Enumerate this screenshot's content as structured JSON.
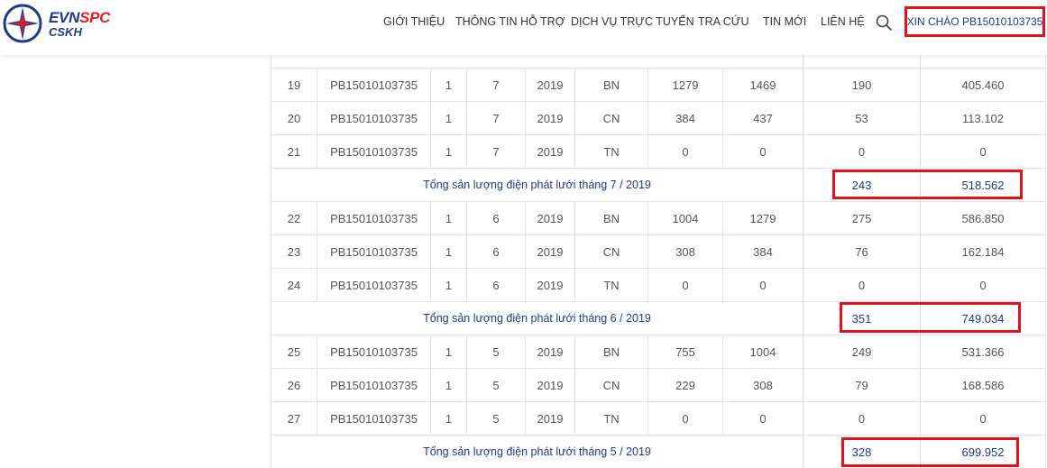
{
  "header": {
    "logo": {
      "brand": "EVN",
      "brand_accent": "SPC",
      "sub": "CSKH"
    },
    "nav": [
      "GIỚI THIỆU",
      "THÔNG TIN HỖ TRỢ",
      "DỊCH VỤ TRỰC TUYẾN",
      "TRA CỨU",
      "TIN MỚI",
      "LIÊN HỆ"
    ],
    "greeting": "XIN CHÀO PB15010103735"
  },
  "colors": {
    "brand_blue": "#1d3a8f",
    "brand_red": "#e31e24",
    "highlight": "#e0121c"
  },
  "table": {
    "rows": [
      {
        "type": "data",
        "cells": [
          "19",
          "PB15010103735",
          "1",
          "7",
          "2019",
          "BN",
          "1279",
          "1469",
          "190",
          "405.460"
        ]
      },
      {
        "type": "data",
        "cells": [
          "20",
          "PB15010103735",
          "1",
          "7",
          "2019",
          "CN",
          "384",
          "437",
          "53",
          "113.102"
        ]
      },
      {
        "type": "data",
        "cells": [
          "21",
          "PB15010103735",
          "1",
          "7",
          "2019",
          "TN",
          "0",
          "0",
          "0",
          "0"
        ]
      },
      {
        "type": "summary",
        "label": "Tổng sản lượng điện phát lưới tháng 7 / 2019",
        "kwh": "243",
        "amount": "518.562"
      },
      {
        "type": "data",
        "cells": [
          "22",
          "PB15010103735",
          "1",
          "6",
          "2019",
          "BN",
          "1004",
          "1279",
          "275",
          "586.850"
        ]
      },
      {
        "type": "data",
        "cells": [
          "23",
          "PB15010103735",
          "1",
          "6",
          "2019",
          "CN",
          "308",
          "384",
          "76",
          "162.184"
        ]
      },
      {
        "type": "data",
        "cells": [
          "24",
          "PB15010103735",
          "1",
          "6",
          "2019",
          "TN",
          "0",
          "0",
          "0",
          "0"
        ]
      },
      {
        "type": "summary",
        "label": "Tổng sản lượng điện phát lưới tháng 6 / 2019",
        "kwh": "351",
        "amount": "749.034"
      },
      {
        "type": "data",
        "cells": [
          "25",
          "PB15010103735",
          "1",
          "5",
          "2019",
          "BN",
          "755",
          "1004",
          "249",
          "531.366"
        ]
      },
      {
        "type": "data",
        "cells": [
          "26",
          "PB15010103735",
          "1",
          "5",
          "2019",
          "CN",
          "229",
          "308",
          "79",
          "168.586"
        ]
      },
      {
        "type": "data",
        "cells": [
          "27",
          "PB15010103735",
          "1",
          "5",
          "2019",
          "TN",
          "0",
          "0",
          "0",
          "0"
        ]
      },
      {
        "type": "summary",
        "label": "Tổng sản lượng điện phát lưới tháng 5 / 2019",
        "kwh": "328",
        "amount": "699.952"
      }
    ]
  }
}
